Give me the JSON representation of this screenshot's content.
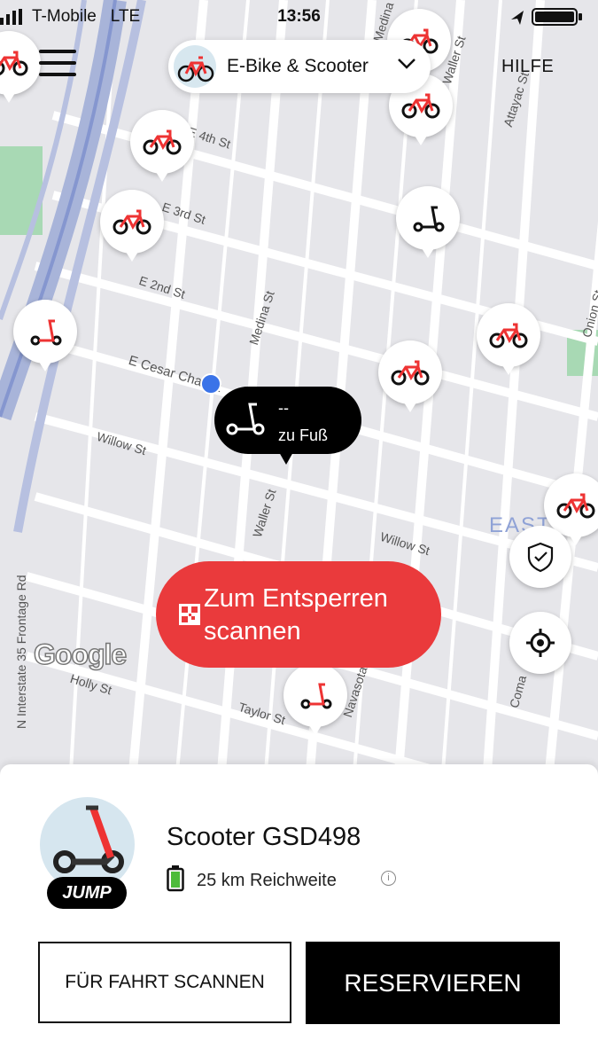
{
  "status_bar": {
    "carrier": "T-Mobile",
    "network": "LTE",
    "time": "13:56"
  },
  "header": {
    "mode_label": "E-Bike & Scooter",
    "help_label": "HILFE"
  },
  "map": {
    "streets": [
      "E 4th St",
      "E 3rd St",
      "E 2nd St",
      "E Cesar Chavez",
      "Willow St",
      "Waller St",
      "Medina St",
      "Willow St",
      "N Interstate 35 Frontage Rd",
      "Holly St",
      "Taylor St",
      "Navasota St",
      "Onion St",
      "Attayac St",
      "Coma",
      "Medina St",
      "Waller St",
      "EAST AV"
    ],
    "callout": {
      "distance": "--",
      "mode": "zu Fuß"
    },
    "scan_button": "Zum Entsperren scannen",
    "attribution": "Google",
    "accent_color": "#ea3a3c"
  },
  "vehicle": {
    "name": "Scooter GSD498",
    "brand_badge": "JUMP",
    "range": "25 km Reichweite",
    "info": "i"
  },
  "actions": {
    "scan_ride": "FÜR FAHRT SCANNEN",
    "reserve": "RESERVIEREN"
  }
}
